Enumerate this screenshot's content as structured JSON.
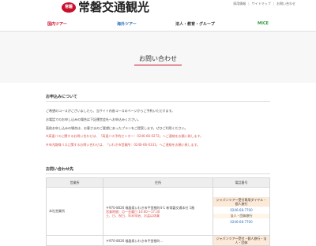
{
  "header": {
    "logo_mark": "常磐",
    "logo_text": "常磐交通観光",
    "utility_links": [
      "採用情報",
      "サイトマップ",
      "お問い合わせ"
    ]
  },
  "nav": {
    "domestic": "国内ツアー",
    "overseas": "海外ツアー",
    "corporate": "法人・教育・グループ",
    "mice": "MICE"
  },
  "hero": {
    "title": "お問い合わせ"
  },
  "apply_section": {
    "title": "お申込みについて",
    "lines": [
      "ご希望のコースがございましたら、当サイト内各コースのページからご予約いただけます。",
      "お電話でのお申し込みの場合は下記運営会社へお申込みください。",
      "直前お申し込みの場合は、お客さまのご要望にあったプランをご提案します。ぜひご利用ください。"
    ],
    "red_lines": [
      "※高速バスに関するお問い合わせは、「高速バス予約センター：0246-66-0272」へご連絡をお願い致します。",
      "※市内路線バスに関するお問い合わせは、「いわき市営業所：0246-66-0331」へご連絡をお願い致します。"
    ]
  },
  "contact_section": {
    "title": "お問い合わせ先",
    "table": {
      "headers": [
        "営業所",
        "住所",
        "電話番号"
      ],
      "rows": [
        {
          "office": "本社営業所",
          "address": [
            "〒970-8026 福島県いわき市平堂根町4-1 新常磐交通本社 1階",
            "営業時間：月〜金曜日 10:00〜17:30",
            "土、日、祝日、年末年始、お盆は休業"
          ],
          "phones": [
            {
              "label": "ジャパンツアー受付専用ダイヤル・個人旅行",
              "number": "0246-68-7700"
            },
            {
              "label": "法人・団体旅行",
              "number": "0246-68-7700"
            }
          ]
        },
        {
          "office": "",
          "address": [
            "〒970-8026 福島県いわき市平堂根町..."
          ],
          "phones": [
            {
              "label": "ジャパンツアー受付・個人旅行・法人・団体",
              "number": ""
            }
          ]
        }
      ]
    }
  },
  "colors": {
    "brand_red": "#c8102e",
    "overseas_blue": "#2a6fb8",
    "mice_green": "#2e9a3a",
    "notice_red": "#d9534f"
  }
}
